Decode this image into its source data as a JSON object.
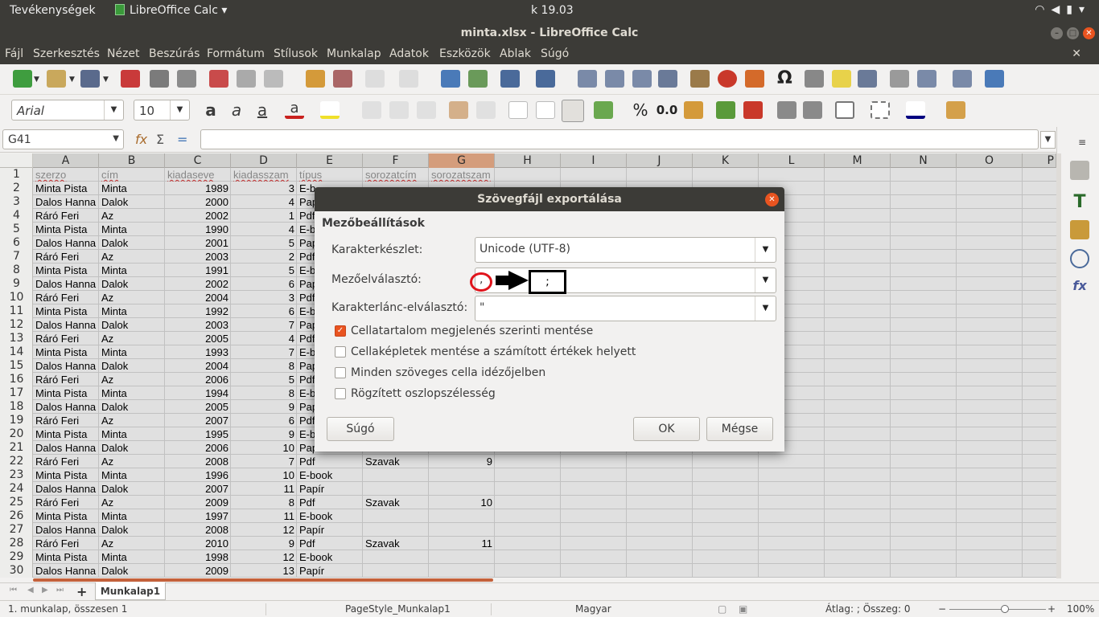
{
  "topbar": {
    "activities": "Tevékenységek",
    "app": "LibreOffice Calc",
    "clock": "k 19.03"
  },
  "window": {
    "title": "minta.xlsx - LibreOffice Calc"
  },
  "menu": [
    "Fájl",
    "Szerkesztés",
    "Nézet",
    "Beszúrás",
    "Formátum",
    "Stílusok",
    "Munkalap",
    "Adatok",
    "Eszközök",
    "Ablak",
    "Súgó"
  ],
  "toolbar": {
    "font_name": "Arial",
    "font_size": "10",
    "percent_label": "%",
    "decimal_label": "0.0"
  },
  "formula_bar": {
    "cell_ref": "G41",
    "value": ""
  },
  "columns": [
    "A",
    "B",
    "C",
    "D",
    "E",
    "F",
    "G",
    "H",
    "I",
    "J",
    "K",
    "L",
    "M",
    "N",
    "O",
    "P"
  ],
  "selected_column": "G",
  "header_row": [
    "szerzo",
    "cím",
    "kiadaseve",
    "kiadasszam",
    "típus",
    "sorozatcím",
    "sorozatszam"
  ],
  "rows": [
    {
      "n": "2",
      "a": "Minta Pista",
      "b": "Minta",
      "c": "1989",
      "d": "3",
      "e": "E-b",
      "f": "",
      "g": ""
    },
    {
      "n": "3",
      "a": "Dalos Hanna",
      "b": "Dalok",
      "c": "2000",
      "d": "4",
      "e": "Pap",
      "f": "",
      "g": ""
    },
    {
      "n": "4",
      "a": "Ráró Feri",
      "b": "Az",
      "c": "2002",
      "d": "1",
      "e": "Pdf",
      "f": "",
      "g": ""
    },
    {
      "n": "5",
      "a": "Minta Pista",
      "b": "Minta",
      "c": "1990",
      "d": "4",
      "e": "E-b",
      "f": "",
      "g": ""
    },
    {
      "n": "6",
      "a": "Dalos Hanna",
      "b": "Dalok",
      "c": "2001",
      "d": "5",
      "e": "Pap",
      "f": "",
      "g": ""
    },
    {
      "n": "7",
      "a": "Ráró Feri",
      "b": "Az",
      "c": "2003",
      "d": "2",
      "e": "Pdf",
      "f": "",
      "g": ""
    },
    {
      "n": "8",
      "a": "Minta Pista",
      "b": "Minta",
      "c": "1991",
      "d": "5",
      "e": "E-b",
      "f": "",
      "g": ""
    },
    {
      "n": "9",
      "a": "Dalos Hanna",
      "b": "Dalok",
      "c": "2002",
      "d": "6",
      "e": "Pap",
      "f": "",
      "g": ""
    },
    {
      "n": "10",
      "a": "Ráró Feri",
      "b": "Az",
      "c": "2004",
      "d": "3",
      "e": "Pdf",
      "f": "",
      "g": ""
    },
    {
      "n": "11",
      "a": "Minta Pista",
      "b": "Minta",
      "c": "1992",
      "d": "6",
      "e": "E-b",
      "f": "",
      "g": ""
    },
    {
      "n": "12",
      "a": "Dalos Hanna",
      "b": "Dalok",
      "c": "2003",
      "d": "7",
      "e": "Pap",
      "f": "",
      "g": ""
    },
    {
      "n": "13",
      "a": "Ráró Feri",
      "b": "Az",
      "c": "2005",
      "d": "4",
      "e": "Pdf",
      "f": "",
      "g": ""
    },
    {
      "n": "14",
      "a": "Minta Pista",
      "b": "Minta",
      "c": "1993",
      "d": "7",
      "e": "E-b",
      "f": "",
      "g": ""
    },
    {
      "n": "15",
      "a": "Dalos Hanna",
      "b": "Dalok",
      "c": "2004",
      "d": "8",
      "e": "Pap",
      "f": "",
      "g": ""
    },
    {
      "n": "16",
      "a": "Ráró Feri",
      "b": "Az",
      "c": "2006",
      "d": "5",
      "e": "Pdf",
      "f": "",
      "g": ""
    },
    {
      "n": "17",
      "a": "Minta Pista",
      "b": "Minta",
      "c": "1994",
      "d": "8",
      "e": "E-b",
      "f": "",
      "g": ""
    },
    {
      "n": "18",
      "a": "Dalos Hanna",
      "b": "Dalok",
      "c": "2005",
      "d": "9",
      "e": "Pap",
      "f": "",
      "g": ""
    },
    {
      "n": "19",
      "a": "Ráró Feri",
      "b": "Az",
      "c": "2007",
      "d": "6",
      "e": "Pdf",
      "f": "",
      "g": ""
    },
    {
      "n": "20",
      "a": "Minta Pista",
      "b": "Minta",
      "c": "1995",
      "d": "9",
      "e": "E-b",
      "f": "",
      "g": ""
    },
    {
      "n": "21",
      "a": "Dalos Hanna",
      "b": "Dalok",
      "c": "2006",
      "d": "10",
      "e": "Papí",
      "f": "",
      "g": ""
    },
    {
      "n": "22",
      "a": "Ráró Feri",
      "b": "Az",
      "c": "2008",
      "d": "7",
      "e": "Pdf",
      "f": "Szavak",
      "g": "9"
    },
    {
      "n": "23",
      "a": "Minta Pista",
      "b": "Minta",
      "c": "1996",
      "d": "10",
      "e": "E-book",
      "f": "",
      "g": ""
    },
    {
      "n": "24",
      "a": "Dalos Hanna",
      "b": "Dalok",
      "c": "2007",
      "d": "11",
      "e": "Papír",
      "f": "",
      "g": ""
    },
    {
      "n": "25",
      "a": "Ráró Feri",
      "b": "Az",
      "c": "2009",
      "d": "8",
      "e": "Pdf",
      "f": "Szavak",
      "g": "10"
    },
    {
      "n": "26",
      "a": "Minta Pista",
      "b": "Minta",
      "c": "1997",
      "d": "11",
      "e": "E-book",
      "f": "",
      "g": ""
    },
    {
      "n": "27",
      "a": "Dalos Hanna",
      "b": "Dalok",
      "c": "2008",
      "d": "12",
      "e": "Papír",
      "f": "",
      "g": ""
    },
    {
      "n": "28",
      "a": "Ráró Feri",
      "b": "Az",
      "c": "2010",
      "d": "9",
      "e": "Pdf",
      "f": "Szavak",
      "g": "11"
    },
    {
      "n": "29",
      "a": "Minta Pista",
      "b": "Minta",
      "c": "1998",
      "d": "12",
      "e": "E-book",
      "f": "",
      "g": ""
    },
    {
      "n": "30",
      "a": "Dalos Hanna",
      "b": "Dalok",
      "c": "2009",
      "d": "13",
      "e": "Papír",
      "f": "",
      "g": ""
    }
  ],
  "sheet_tab": "Munkalap1",
  "status": {
    "sheet": "1. munkalap, összesen 1",
    "page_style": "PageStyle_Munkalap1",
    "language": "Magyar",
    "sum": "Átlag: ; Összeg: 0",
    "zoom": "100%"
  },
  "dialog": {
    "title": "Szövegfájl exportálása",
    "section": "Mezőbeállítások",
    "charset_label": "Karakterkészlet:",
    "charset_value": "Unicode (UTF-8)",
    "field_sep_label": "Mezőelválasztó:",
    "field_sep_value": ",",
    "field_sep_annotation": ";",
    "string_delim_label": "Karakterlánc-elválasztó:",
    "string_delim_value": "\"",
    "options": [
      {
        "label": "Cellatartalom megjelenés szerinti mentése",
        "checked": true
      },
      {
        "label": "Cellaképletek mentése a számított értékek helyett",
        "checked": false
      },
      {
        "label": "Minden szöveges cella idézőjelben",
        "checked": false
      },
      {
        "label": "Rögzített oszlopszélesség",
        "checked": false
      }
    ],
    "help_button": "Súgó",
    "ok_button": "OK",
    "cancel_button": "Mégse"
  },
  "colors": {
    "accent": "#e95420",
    "titlebar": "#3c3b37",
    "selected_header": "#f2b38e",
    "annotation_red": "#e0141c"
  }
}
